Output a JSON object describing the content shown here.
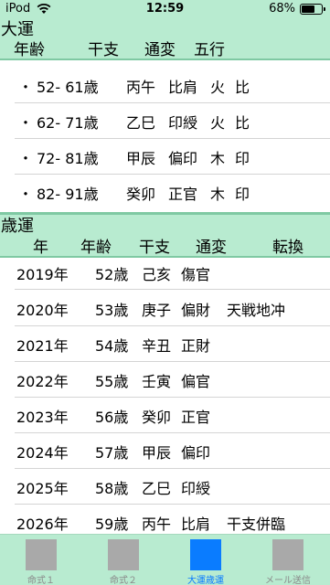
{
  "status_bar": {
    "carrier": "iPod",
    "time": "12:59",
    "battery_percent": "68%",
    "battery_level": 0.68
  },
  "taiun": {
    "title": "大運",
    "columns": [
      "年齢",
      "干支",
      "通変",
      "五行"
    ],
    "rows": [
      {
        "bullet": "・",
        "age": "52- 61歳",
        "kanshi": "丙午",
        "tsuhen": "比肩",
        "gogyo": "火",
        "rel": "比"
      },
      {
        "bullet": "・",
        "age": "62- 71歳",
        "kanshi": "乙巳",
        "tsuhen": "印綬",
        "gogyo": "火",
        "rel": "比"
      },
      {
        "bullet": "・",
        "age": "72- 81歳",
        "kanshi": "甲辰",
        "tsuhen": "偏印",
        "gogyo": "木",
        "rel": "印"
      },
      {
        "bullet": "・",
        "age": "82- 91歳",
        "kanshi": "癸卯",
        "tsuhen": "正官",
        "gogyo": "木",
        "rel": "印"
      }
    ]
  },
  "saiun": {
    "title": "歳運",
    "columns": [
      "年",
      "年齢",
      "干支",
      "通変",
      "転換"
    ],
    "rows": [
      {
        "year": "2019年",
        "age": "52歳",
        "kanshi": "己亥",
        "tsuhen": "傷官",
        "tenkan": ""
      },
      {
        "year": "2020年",
        "age": "53歳",
        "kanshi": "庚子",
        "tsuhen": "偏財",
        "tenkan": "天戦地冲"
      },
      {
        "year": "2021年",
        "age": "54歳",
        "kanshi": "辛丑",
        "tsuhen": "正財",
        "tenkan": ""
      },
      {
        "year": "2022年",
        "age": "55歳",
        "kanshi": "壬寅",
        "tsuhen": "偏官",
        "tenkan": ""
      },
      {
        "year": "2023年",
        "age": "56歳",
        "kanshi": "癸卯",
        "tsuhen": "正官",
        "tenkan": ""
      },
      {
        "year": "2024年",
        "age": "57歳",
        "kanshi": "甲辰",
        "tsuhen": "偏印",
        "tenkan": ""
      },
      {
        "year": "2025年",
        "age": "58歳",
        "kanshi": "乙巳",
        "tsuhen": "印綬",
        "tenkan": ""
      },
      {
        "year": "2026年",
        "age": "59歳",
        "kanshi": "丙午",
        "tsuhen": "比肩",
        "tenkan": "干支併臨"
      }
    ]
  },
  "tab_bar": {
    "tabs": [
      {
        "label": "命式１",
        "active": false
      },
      {
        "label": "命式２",
        "active": false
      },
      {
        "label": "大運歳運",
        "active": true
      },
      {
        "label": "メール送信",
        "active": false
      }
    ]
  },
  "colors": {
    "header_bg": "#b8ebd0",
    "accent": "#0a7cff",
    "divider": "#d4d4d4",
    "icon_gray": "#a9a9a9"
  }
}
